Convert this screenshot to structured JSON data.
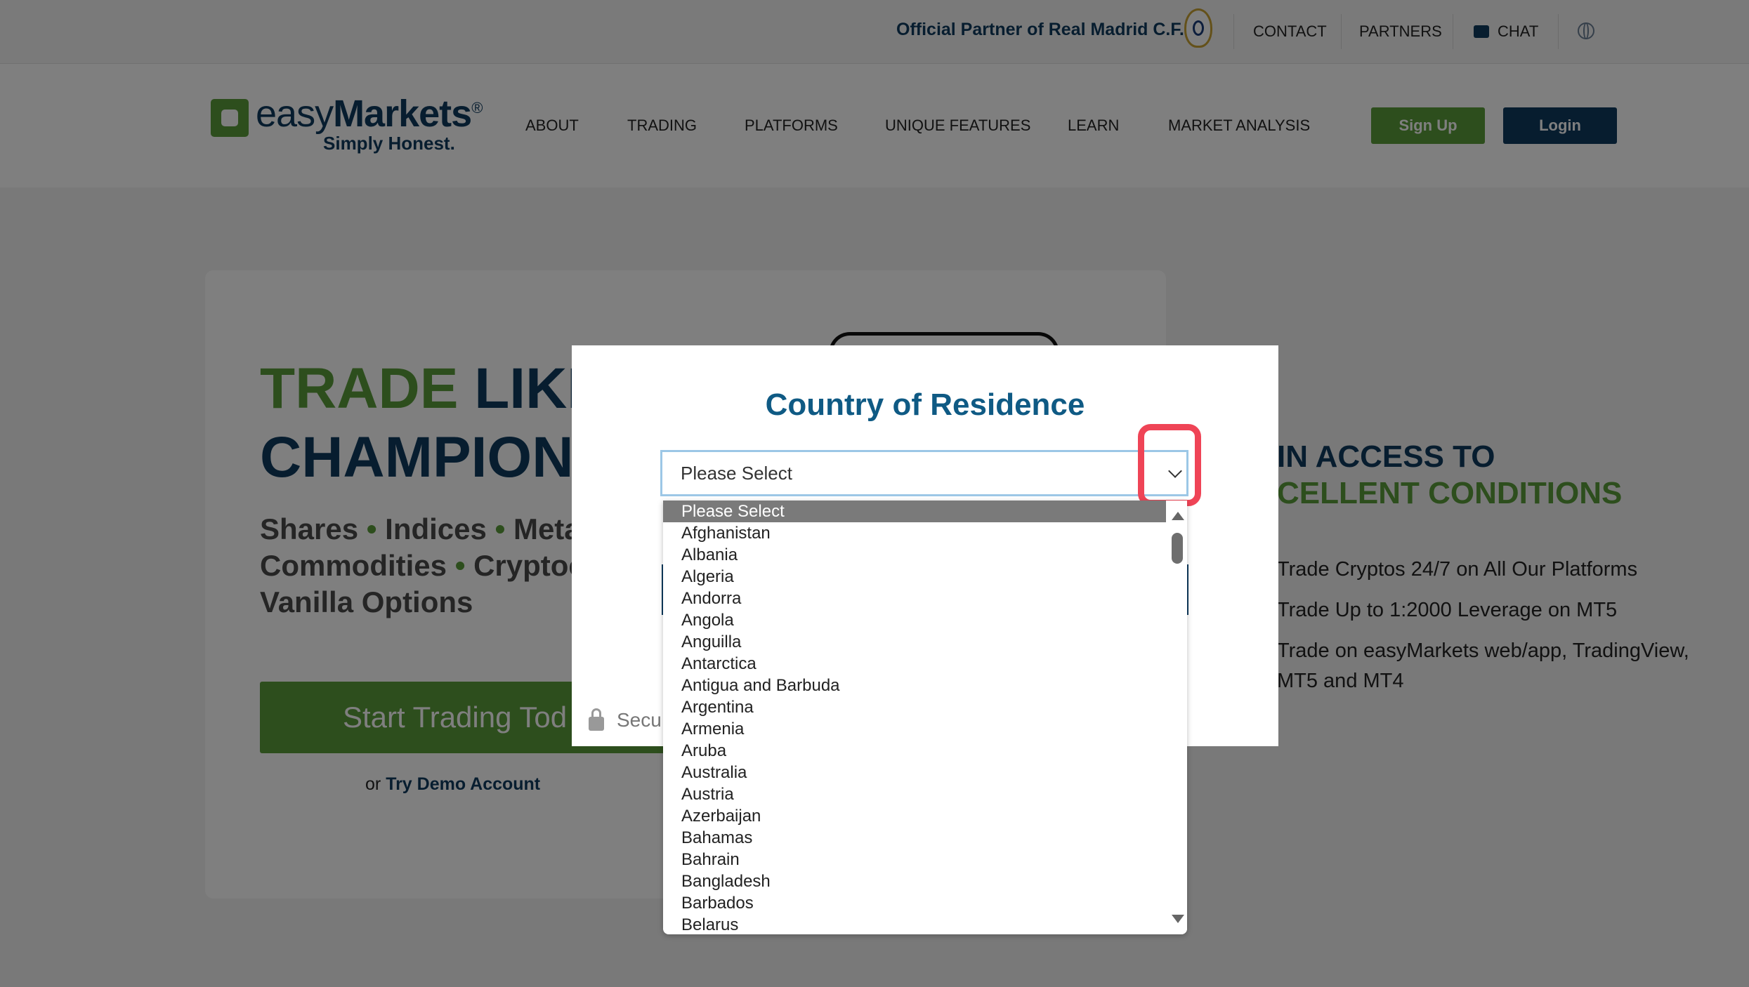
{
  "topbar": {
    "partner_text": "Official Partner of Real Madrid C.F.",
    "contact": "CONTACT",
    "partners": "PARTNERS",
    "chat": "CHAT"
  },
  "header": {
    "logo_easy": "easy",
    "logo_markets": "Markets",
    "logo_reg": "®",
    "tagline": "Simply Honest.",
    "nav": [
      "ABOUT",
      "TRADING",
      "PLATFORMS",
      "UNIQUE FEATURES",
      "LEARN",
      "MARKET ANALYSIS"
    ],
    "signup": "Sign Up",
    "login": "Login"
  },
  "hero": {
    "title_green": "TRADE",
    "title_rest": " LIKE",
    "title_line2": "CHAMPION",
    "sub_line1_a": "Shares",
    "sub_line1_b": "Indices",
    "sub_line1_c": "Meta",
    "sub_line2_a": "Commodities",
    "sub_line2_b": "Cryptoc",
    "sub_line3": "Vanilla Options",
    "cta": "Start Trading Tod",
    "demo_prefix": "or ",
    "demo_link": "Try Demo Account"
  },
  "side": {
    "line1": "IN ACCESS TO",
    "line2": "CELLENT CONDITIONS",
    "bullets": [
      "Trade Cryptos 24/7 on All Our Platforms",
      "Trade Up to 1:2000 Leverage on MT5",
      "Trade on easyMarkets web/app, TradingView, MT5 and MT4"
    ]
  },
  "modal": {
    "title": "Country of Residence",
    "selected_value": "Please Select",
    "secure_text": "Secu",
    "options": [
      "Please Select",
      "Afghanistan",
      "Albania",
      "Algeria",
      "Andorra",
      "Angola",
      "Anguilla",
      "Antarctica",
      "Antigua and Barbuda",
      "Argentina",
      "Armenia",
      "Aruba",
      "Australia",
      "Austria",
      "Azerbaijan",
      "Bahamas",
      "Bahrain",
      "Bangladesh",
      "Barbados",
      "Belarus"
    ]
  },
  "colors": {
    "brand_green": "#5b9c3b",
    "brand_navy": "#0f3b5f",
    "highlight_red": "#ef4456"
  }
}
